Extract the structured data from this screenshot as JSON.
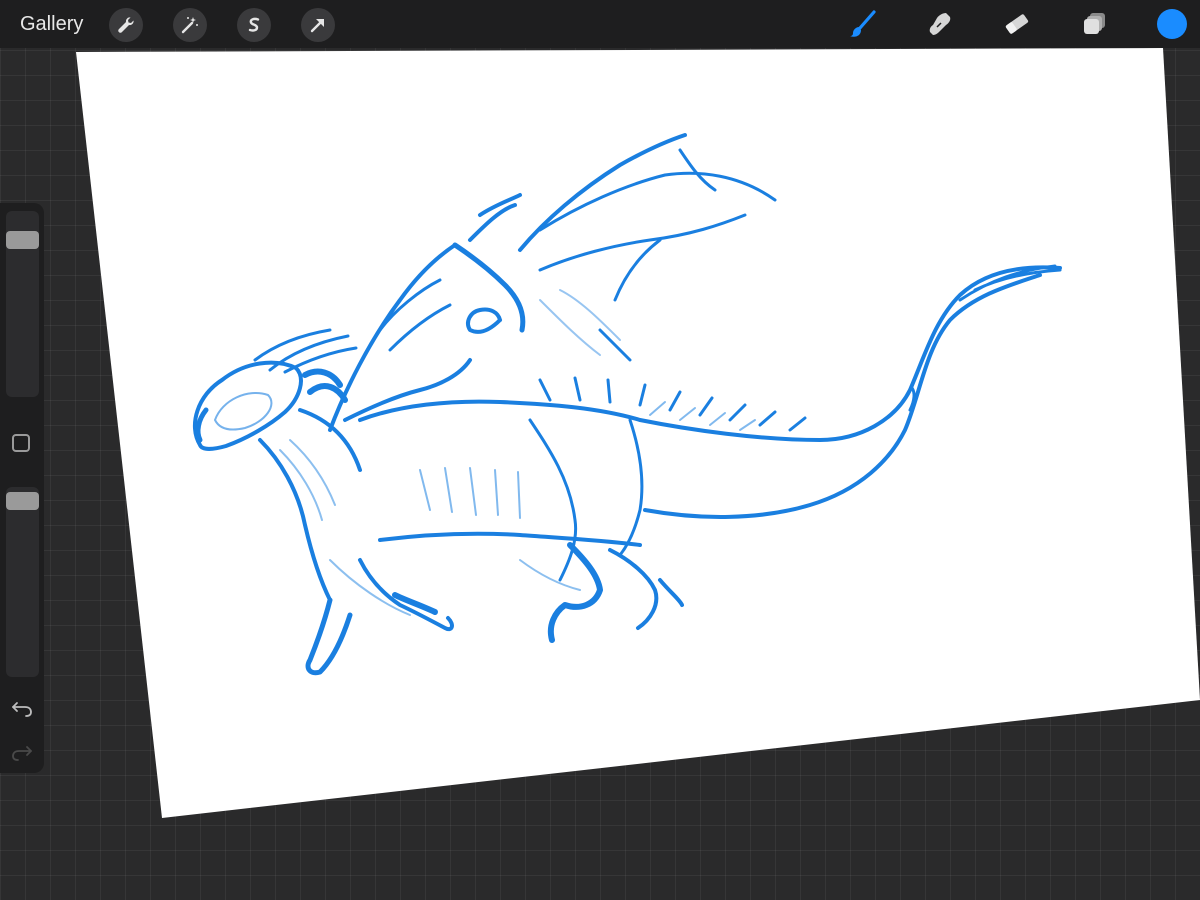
{
  "app": {
    "gallery_label": "Gallery"
  },
  "toolbar_left": [
    {
      "name": "actions-wrench-icon"
    },
    {
      "name": "adjustments-magic-wand-icon"
    },
    {
      "name": "selection-s-icon"
    },
    {
      "name": "transform-arrow-icon"
    }
  ],
  "toolbar_right": [
    {
      "name": "brush-icon",
      "active": true
    },
    {
      "name": "smudge-icon",
      "active": false
    },
    {
      "name": "eraser-icon",
      "active": false
    },
    {
      "name": "layers-icon",
      "active": false
    }
  ],
  "current_color": "#1a8cff",
  "sidebar": {
    "brush_size": 0.9,
    "opacity": 0.95,
    "modify_button": "square-icon",
    "undo": "undo-arrow-icon",
    "redo": "redo-arrow-icon",
    "redo_enabled": false
  },
  "colors": {
    "ui_background": "#1e1e1f",
    "canvas_background": "#2a2a2b",
    "paper": "#ffffff",
    "stroke": "#1a7fe0",
    "active_tool": "#1a8cff",
    "icon": "#d6d6d6"
  }
}
